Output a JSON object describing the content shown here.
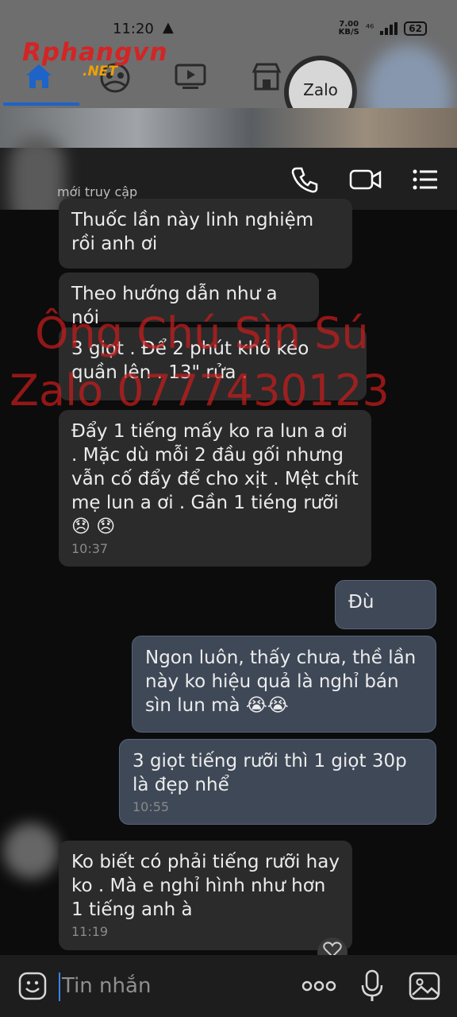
{
  "status_bar": {
    "time": "11:20",
    "net_speed_top": "7.00",
    "net_speed_bottom": "KB/S",
    "signal_label": "⁴⁶",
    "battery": "62"
  },
  "watermark_logo": {
    "brand": "Rphangvn",
    "suffix": ".NET"
  },
  "zalo_badge": "Zalo",
  "chat_header": {
    "last_seen": "mới truy cập"
  },
  "messages": [
    {
      "text": "Thuốc lần này linh nghiệm rồi anh ơi",
      "time": ""
    },
    {
      "text": "Theo hướng dẫn như a nói",
      "time": ""
    },
    {
      "text": "3 giọt . Để 2 phút khô kéo quần lên . 13\" rửa .",
      "time": ""
    },
    {
      "text": "Đẩy 1 tiếng mấy ko ra lun a ơi . Mặc dù mỗi 2 đầu gối nhưng vẫn cố đẩy để cho xịt . Mệt chít mẹ lun a ơi . Gần 1 tiéng rưỡi 😞 😞",
      "time": "10:37"
    },
    {
      "text": "Đù",
      "time": ""
    },
    {
      "text": "Ngon luôn, thấy chưa, thề lần này ko hiệu quả là nghỉ bán sìn lun mà 😭😭",
      "time": ""
    },
    {
      "text": "3 giọt tiếng rưỡi thì 1 giọt 30p là đẹp nhể",
      "time": "10:55"
    },
    {
      "text": "Ko biết có phải tiếng rưỡi hay ko . Mà e nghỉ hình như hơn 1 tiếng anh à",
      "time": "11:19"
    }
  ],
  "watermark": {
    "line1": "Ông Chú Sìn Sú",
    "line2": "Zalo 0777430123"
  },
  "input": {
    "placeholder": "Tin nhắn"
  }
}
